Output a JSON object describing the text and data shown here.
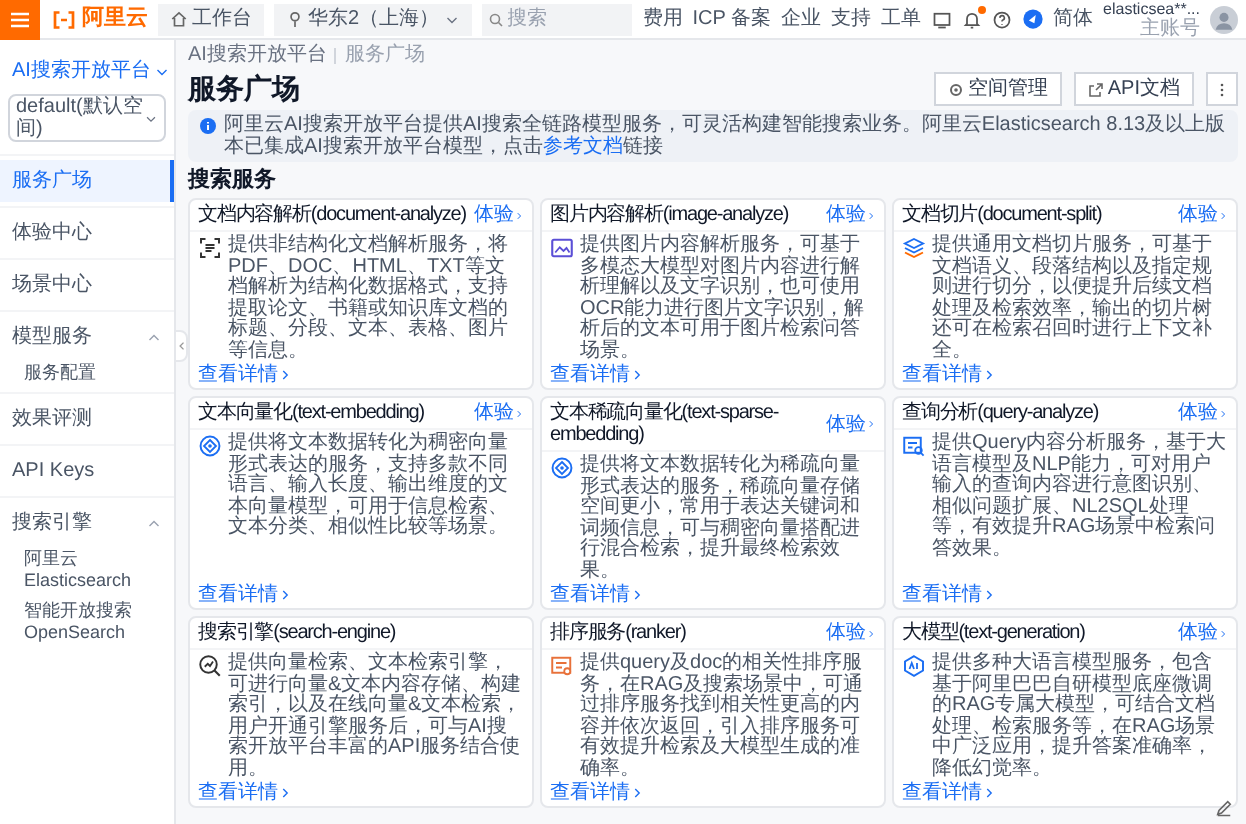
{
  "topbar": {
    "logo": "阿里云",
    "workbench": "工作台",
    "region": "华东2（上海）",
    "search": {
      "placeholder": "搜索"
    },
    "links": [
      "费用",
      "ICP 备案",
      "企业",
      "支持",
      "工单"
    ],
    "notification_dot": true,
    "language": "简体",
    "account": {
      "name": "elasticsea**...",
      "role": "主账号"
    }
  },
  "sidebar": {
    "product": "AI搜索开放平台",
    "workspace": "default(默认空间)",
    "items": [
      {
        "label": "服务广场",
        "selected": true
      },
      {
        "label": "体验中心",
        "selected": false
      },
      {
        "label": "场景中心",
        "selected": false
      },
      {
        "label": "模型服务",
        "selected": false,
        "expanded": true,
        "children": [
          {
            "label": "服务配置",
            "selected": false
          }
        ]
      },
      {
        "label": "效果评测",
        "selected": false
      },
      {
        "label": "API Keys",
        "selected": false
      },
      {
        "label": "搜索引擎",
        "selected": false,
        "expanded": true,
        "children": [
          {
            "label": "阿里云Elasticsearch",
            "selected": false
          },
          {
            "label": "智能开放搜索OpenSearch",
            "selected": false
          }
        ]
      }
    ]
  },
  "breadcrumb": [
    "AI搜索开放平台",
    "服务广场"
  ],
  "page": {
    "title": "服务广场",
    "actions": [
      {
        "kind": "settings",
        "label": "空间管理"
      },
      {
        "kind": "external",
        "label": "API文档"
      },
      {
        "kind": "more"
      }
    ]
  },
  "notice": {
    "text_before": "阿里云AI搜索开放平台提供AI搜索全链路模型服务，可灵活构建智能搜索业务。阿里云Elasticsearch 8.13及以上版本已集成AI搜索开放平台模型，点击",
    "link": "参考文档",
    "text_after": "链接"
  },
  "section": {
    "title": "搜索服务",
    "cards": [
      {
        "title": "文档内容解析(document-analyze)",
        "try": "体验",
        "kind": "scan",
        "description": "提供非结构化文档解析服务，将PDF、DOC、HTML、TXT等文档解析为结构化数据格式，支持提取论文、书籍或知识库文档的标题、分段、文本、表格、图片等信息。",
        "details": "查看详情"
      },
      {
        "title": "图片内容解析(image-analyze)",
        "try": "体验",
        "kind": "image",
        "description": "提供图片内容解析服务，可基于多模态大模型对图片内容进行解析理解以及文字识别，也可使用OCR能力进行图片文字识别，解析后的文本可用于图片检索问答场景。",
        "details": "查看详情"
      },
      {
        "title": "文档切片(document-split)",
        "try": "体验",
        "kind": "layers",
        "description": "提供通用文档切片服务，可基于文档语义、段落结构以及指定规则进行切分，以便提升后续文档处理及检索效率，输出的切片树还可在检索召回时进行上下文补全。",
        "details": "查看详情"
      },
      {
        "title": "文本向量化(text-embedding)",
        "try": "体验",
        "kind": "vector",
        "description": "提供将文本数据转化为稠密向量形式表达的服务，支持多款不同语言、输入长度、输出维度的文本向量模型，可用于信息检索、文本分类、相似性比较等场景。",
        "details": "查看详情"
      },
      {
        "title": "文本稀疏向量化(text-sparse-embedding)",
        "try": "体验",
        "kind": "vector",
        "description": "提供将文本数据转化为稀疏向量形式表达的服务，稀疏向量存储空间更小，常用于表达关键词和词频信息，可与稠密向量搭配进行混合检索，提升最终检索效果。",
        "details": "查看详情"
      },
      {
        "title": "查询分析(query-analyze)",
        "try": "体验",
        "kind": "query",
        "description": "提供Query内容分析服务，基于大语言模型及NLP能力，可对用户输入的查询内容进行意图识别、相似问题扩展、NL2SQL处理等，有效提升RAG场景中检索问答效果。",
        "details": "查看详情"
      },
      {
        "title": "搜索引擎(search-engine)",
        "kind": "engine",
        "description": "提供向量检索、文本检索引擎，可进行向量&文本内容存储、构建索引，以及在线向量&文本检索，用户开通引擎服务后，可与AI搜索开放平台丰富的API服务结合使用。",
        "details": "查看详情"
      },
      {
        "title": "排序服务(ranker)",
        "try": "体验",
        "kind": "ranker",
        "description": "提供query及doc的相关性排序服务，在RAG及搜索场景中，可通过排序服务找到相关性更高的内容并依次返回，引入排序服务可有效提升检索及大模型生成的准确率。",
        "details": "查看详情"
      },
      {
        "title": "大模型(text-generation)",
        "try": "体验",
        "kind": "llm",
        "description": "提供多种大语言模型服务，包含基于阿里巴巴自研模型底座微调的RAG专属大模型，可结合文档处理、检索服务等，在RAG场景中广泛应用，提升答案准确率，降低幻觉率。",
        "details": "查看详情"
      }
    ]
  }
}
